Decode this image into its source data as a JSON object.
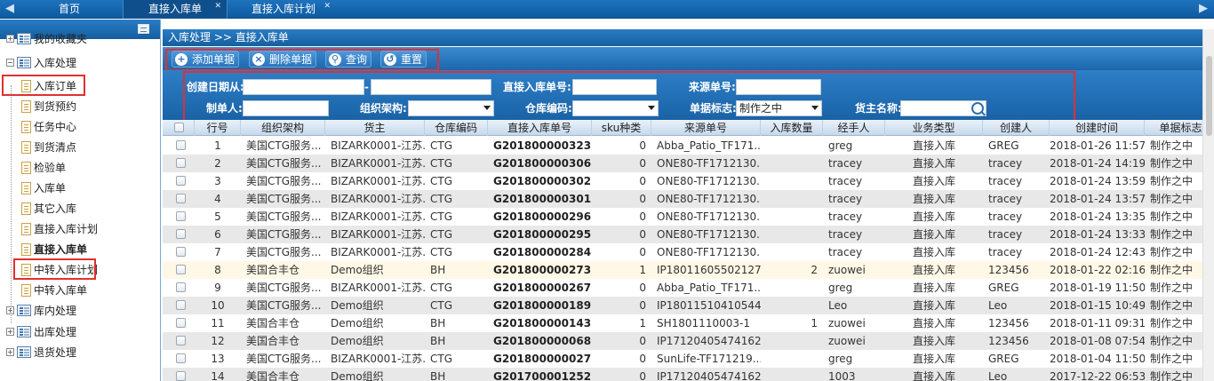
{
  "top_tabs": [
    {
      "label": "首页",
      "closable": false
    },
    {
      "label": "直接入库单",
      "closable": true,
      "active": true
    },
    {
      "label": "直接入库计划",
      "closable": true
    }
  ],
  "nav": {
    "items": [
      {
        "label": "我的收藏夹",
        "type": "group",
        "expanded": false
      },
      {
        "label": "入库处理",
        "type": "group",
        "expanded": true
      },
      {
        "label": "入库订单",
        "type": "leaf"
      },
      {
        "label": "到货预约",
        "type": "leaf"
      },
      {
        "label": "任务中心",
        "type": "leaf"
      },
      {
        "label": "到货清点",
        "type": "leaf"
      },
      {
        "label": "检验单",
        "type": "leaf"
      },
      {
        "label": "入库单",
        "type": "leaf"
      },
      {
        "label": "其它入库",
        "type": "leaf"
      },
      {
        "label": "直接入库计划",
        "type": "leaf"
      },
      {
        "label": "直接入库单",
        "type": "leaf",
        "selected": true
      },
      {
        "label": "中转入库计划",
        "type": "leaf"
      },
      {
        "label": "中转入库单",
        "type": "leaf"
      },
      {
        "label": "库内处理",
        "type": "group",
        "expanded": false
      },
      {
        "label": "出库处理",
        "type": "group",
        "expanded": false
      },
      {
        "label": "退货处理",
        "type": "group",
        "expanded": false
      }
    ]
  },
  "breadcrumb": "入库处理 >> 直接入库单",
  "toolbar": {
    "add": "添加单据",
    "delete": "删除单据",
    "query": "查询",
    "reset": "重置"
  },
  "filters": {
    "created_from_label": "创建日期从:",
    "created_to_sep": "-",
    "order_no_label": "直接入库单号:",
    "source_no_label": "来源单号:",
    "creator_label": "制单人:",
    "org_label": "组织架构:",
    "warehouse_label": "仓库编码:",
    "status_label": "单据标志:",
    "status_value": "制作之中",
    "owner_label": "货主名称:"
  },
  "grid": {
    "columns": [
      "行号",
      "组织架构",
      "货主",
      "仓库编码",
      "直接入库单号",
      "sku种类",
      "来源单号",
      "入库数量",
      "经手人",
      "业务类型",
      "创建人",
      "创建时间",
      "单据标志"
    ],
    "rows": [
      [
        "1",
        "美国CTG服务...",
        "BIZARK0001-江苏...",
        "CTG",
        "G201800000323",
        "0",
        "Abba_Patio_TF171...",
        "",
        "greg",
        "直接入库",
        "GREG",
        "2018-01-26 11:57",
        "制作之中"
      ],
      [
        "2",
        "美国CTG服务...",
        "BIZARK0001-江苏...",
        "CTG",
        "G201800000306",
        "0",
        "ONE80-TF1712130...",
        "",
        "tracey",
        "直接入库",
        "tracey",
        "2018-01-24 14:19",
        "制作之中"
      ],
      [
        "3",
        "美国CTG服务...",
        "BIZARK0001-江苏...",
        "CTG",
        "G201800000302",
        "0",
        "ONE80-TF1712130...",
        "",
        "tracey",
        "直接入库",
        "tracey",
        "2018-01-24 13:59",
        "制作之中"
      ],
      [
        "4",
        "美国CTG服务...",
        "BIZARK0001-江苏...",
        "CTG",
        "G201800000301",
        "0",
        "ONE80-TF1712130...",
        "",
        "tracey",
        "直接入库",
        "tracey",
        "2018-01-24 13:57",
        "制作之中"
      ],
      [
        "5",
        "美国CTG服务...",
        "BIZARK0001-江苏...",
        "CTG",
        "G201800000296",
        "0",
        "ONE80-TF1712130...",
        "",
        "tracey",
        "直接入库",
        "tracey",
        "2018-01-24 13:35",
        "制作之中"
      ],
      [
        "6",
        "美国CTG服务...",
        "BIZARK0001-江苏...",
        "CTG",
        "G201800000295",
        "0",
        "ONE80-TF1712130...",
        "",
        "tracey",
        "直接入库",
        "tracey",
        "2018-01-24 13:33",
        "制作之中"
      ],
      [
        "7",
        "美国CTG服务...",
        "BIZARK0001-江苏...",
        "CTG",
        "G201800000284",
        "0",
        "ONE80-TF1712130...",
        "",
        "tracey",
        "直接入库",
        "tracey",
        "2018-01-24 12:43",
        "制作之中"
      ],
      [
        "8",
        "美国合丰仓",
        "Demo组织",
        "BH",
        "G201800000273",
        "1",
        "IP18011605502127",
        "2",
        "zuowei",
        "直接入库",
        "123456",
        "2018-01-22 02:16",
        "制作之中"
      ],
      [
        "9",
        "美国CTG服务...",
        "BIZARK0001-江苏...",
        "CTG",
        "G201800000267",
        "0",
        "Abba_Patio_TF171...",
        "",
        "greg",
        "直接入库",
        "GREG",
        "2018-01-19 11:50",
        "制作之中"
      ],
      [
        "10",
        "美国CTG服务...",
        "Demo组织",
        "CTG",
        "G201800000189",
        "0",
        "IP18011510410544",
        "",
        "Leo",
        "直接入库",
        "Leo",
        "2018-01-15 10:49",
        "制作之中"
      ],
      [
        "11",
        "美国合丰仓",
        "Demo组织",
        "BH",
        "G201800000143",
        "1",
        "SH1801110003-1",
        "1",
        "zuowei",
        "直接入库",
        "123456",
        "2018-01-11 09:31",
        "制作之中"
      ],
      [
        "12",
        "美国合丰仓",
        "Demo组织",
        "BH",
        "G201800000068",
        "0",
        "IP17120405474162",
        "",
        "zuowei",
        "直接入库",
        "123456",
        "2018-01-08 07:54",
        "制作之中"
      ],
      [
        "13",
        "美国CTG服务...",
        "BIZARK0001-江苏...",
        "CTG",
        "G201800000027",
        "0",
        "SunLife-TF171219...",
        "",
        "greg",
        "直接入库",
        "GREG",
        "2018-01-04 11:50",
        "制作之中"
      ],
      [
        "14",
        "美国合丰仓",
        "Demo组织",
        "BH",
        "G201700001252",
        "0",
        "IP17120405474162",
        "",
        "1003",
        "直接入库",
        "Leo",
        "2017-12-22 06:53",
        "制作之中"
      ]
    ]
  },
  "colors": {
    "header_blue": "#1d66ab",
    "highlight_red": "#e03030",
    "row_alt": "#e8e8e8"
  }
}
